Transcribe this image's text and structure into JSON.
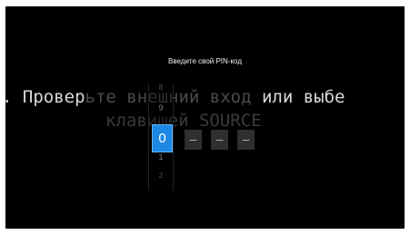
{
  "background_message": {
    "line1_part1": ". Провер",
    "line1_part2": "ьте внешний вход ",
    "line1_part3": "или выбе",
    "line2": "клавишей SOURCE"
  },
  "pin_dialog": {
    "title": "Введите свой PIN-код",
    "picker_digits": [
      "8",
      "9",
      "1",
      "2"
    ],
    "selected_digit": "0",
    "slots": [
      "–",
      "–",
      "–"
    ]
  }
}
